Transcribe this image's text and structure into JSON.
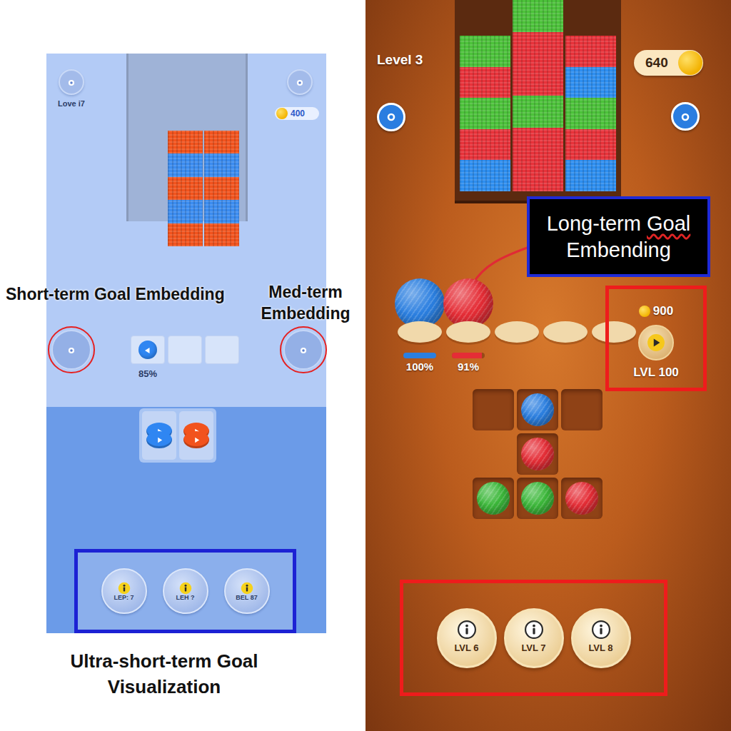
{
  "left_screen": {
    "profile_label": "Love i7",
    "coins": "400",
    "rail_columns": [
      {
        "stripes": [
          "#f2531d",
          "#3b8cf0",
          "#f2531d",
          "#3b8cf0",
          "#f2531d"
        ]
      },
      {
        "stripes": [
          "#f2531d",
          "#3b8cf0",
          "#f2531d",
          "#3b8cf0",
          "#f2531d"
        ]
      }
    ],
    "slots": [
      {
        "filled": true,
        "color": "#2f86f2"
      },
      {
        "filled": false
      },
      {
        "filled": false
      }
    ],
    "progress": "85%",
    "spools": [
      {
        "color": "#2f86f2"
      },
      {
        "color": "#f2531d"
      }
    ],
    "level_buttons": [
      {
        "label": "LEP: 7"
      },
      {
        "label": "LEH ?"
      },
      {
        "label": "BEL 87"
      }
    ]
  },
  "right_screen": {
    "level_title": "Level 3",
    "coins": "640",
    "shelf_columns": [
      {
        "stripes": [
          "#4cc23a",
          "#e8323a",
          "#4cc23a",
          "#e8323a",
          "#2d8ef0"
        ]
      },
      {
        "stripes": [
          "#4cc23a",
          "#e8323a",
          "#e8323a",
          "#4cc23a",
          "#e8323a",
          "#e8323a"
        ]
      },
      {
        "stripes": [
          "#e8323a",
          "#2d8ef0",
          "#4cc23a",
          "#e8323a",
          "#2d8ef0"
        ]
      }
    ],
    "spool_slots": [
      {
        "filled": true,
        "color": "#2b7fe0",
        "level": 1.0,
        "reading": "100%"
      },
      {
        "filled": true,
        "color": "#e52d36",
        "level": 0.91,
        "reading": "91%"
      },
      {
        "filled": false
      },
      {
        "filled": false
      },
      {
        "filled": false
      }
    ],
    "reward": {
      "coins": "900",
      "label": "LVL 100"
    },
    "tray_rows": [
      [
        {
          "filled": false
        },
        {
          "filled": true,
          "color": "#2b7fe0"
        },
        {
          "filled": false
        }
      ],
      [
        {
          "filled": true,
          "color": "#e52d36"
        }
      ],
      [
        {
          "filled": true,
          "color": "#3cb83a"
        },
        {
          "filled": true,
          "color": "#3cb83a"
        },
        {
          "filled": true,
          "color": "#e52d36"
        }
      ]
    ],
    "level_buttons": [
      {
        "label": "LVL 6"
      },
      {
        "label": "LVL 7"
      },
      {
        "label": "LVL 8"
      }
    ]
  },
  "annotations": {
    "short_term": "Short-term Goal Embedding",
    "med_term": [
      "Med-term",
      "Embedding"
    ],
    "long_term": {
      "prefix": "Long-term",
      "underlined": "Goal",
      "line2": "Embending"
    },
    "ultra_short_term": [
      "Ultra-short-term Goal",
      "Visualization"
    ]
  }
}
